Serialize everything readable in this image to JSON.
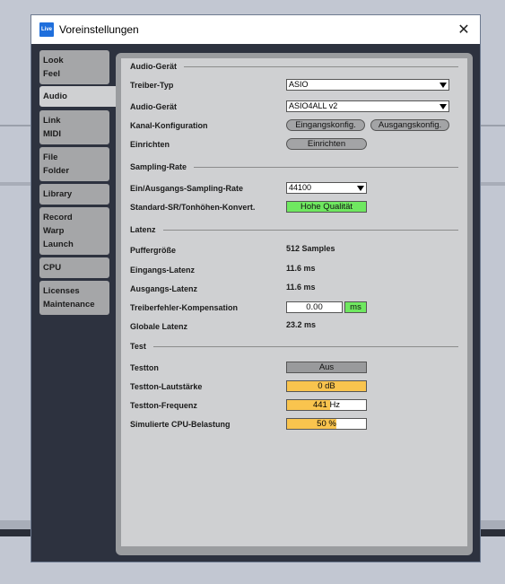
{
  "window": {
    "title": "Voreinstellungen",
    "app_icon_text": "Live"
  },
  "sidebar": {
    "tabs": [
      {
        "line1": "Look",
        "line2": "Feel",
        "line3": ""
      },
      {
        "line1": "Audio",
        "line2": "",
        "line3": ""
      },
      {
        "line1": "Link",
        "line2": "MIDI",
        "line3": ""
      },
      {
        "line1": "File",
        "line2": "Folder",
        "line3": ""
      },
      {
        "line1": "Library",
        "line2": "",
        "line3": ""
      },
      {
        "line1": "Record",
        "line2": "Warp",
        "line3": "Launch"
      },
      {
        "line1": "CPU",
        "line2": "",
        "line3": ""
      },
      {
        "line1": "Licenses",
        "line2": "Maintenance",
        "line3": ""
      }
    ],
    "active": "Audio"
  },
  "audio_device": {
    "heading": "Audio-Gerät",
    "driver_type_label": "Treiber-Typ",
    "driver_type_value": "ASIO",
    "device_label": "Audio-Gerät",
    "device_value": "ASIO4ALL v2",
    "channel_config_label": "Kanal-Konfiguration",
    "input_config_button": "Eingangskonfig.",
    "output_config_button": "Ausgangskonfig.",
    "setup_label": "Einrichten",
    "setup_button": "Einrichten"
  },
  "sample_rate": {
    "heading": "Sampling-Rate",
    "io_rate_label": "Ein/Ausgangs-Sampling-Rate",
    "io_rate_value": "44100",
    "conversion_label": "Standard-SR/Tonhöhen-Konvert.",
    "conversion_value": "Hohe Qualität"
  },
  "latency": {
    "heading": "Latenz",
    "buffer_label": "Puffergröße",
    "buffer_value": "512 Samples",
    "input_label": "Eingangs-Latenz",
    "input_value": "11.6 ms",
    "output_label": "Ausgangs-Latenz",
    "output_value": "11.6 ms",
    "driver_comp_label": "Treiberfehler-Kompensation",
    "driver_comp_value": "0.00",
    "driver_comp_unit": "ms",
    "global_label": "Globale Latenz",
    "global_value": "23.2 ms"
  },
  "test": {
    "heading": "Test",
    "tone_label": "Testton",
    "tone_value": "Aus",
    "volume_label": "Testton-Lautstärke",
    "volume_value": "0 dB",
    "frequency_label": "Testton-Frequenz",
    "frequency_value": "441",
    "frequency_unit": "Hz",
    "frequency_fill_fraction": 0.55,
    "cpu_label": "Simulierte CPU-Belastung",
    "cpu_value": "50 %",
    "cpu_fill_fraction": 0.62
  },
  "colors": {
    "accent_green": "#6fe860",
    "accent_orange": "#f9c44e",
    "window_dark": "#2d323f"
  }
}
